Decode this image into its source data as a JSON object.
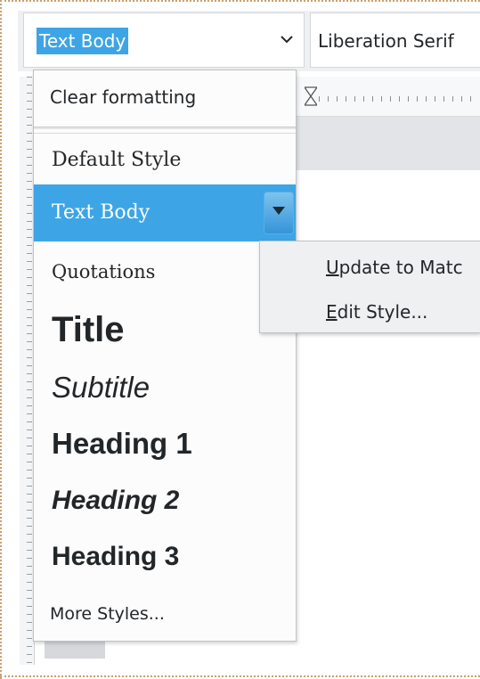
{
  "toolbar": {
    "paragraph_style": "Text Body",
    "font_name": "Liberation Serif"
  },
  "style_menu": {
    "clear_formatting": "Clear formatting",
    "items": [
      "Default Style",
      "Text Body",
      "Quotations",
      "Title",
      "Subtitle",
      "Heading 1",
      "Heading 2",
      "Heading 3"
    ],
    "selected": "Text Body",
    "more_styles": "More Styles..."
  },
  "context_menu": {
    "update_mnemonic": "U",
    "update_rest": "pdate to Matc",
    "edit_mnemonic": "E",
    "edit_rest": "dit Style..."
  },
  "colors": {
    "selection": "#3da5e5",
    "toolbar_bg": "#eef0f2",
    "menu_bg": "#fcfcfc"
  },
  "icons": {
    "style_dropdown": "chevron-down-icon",
    "item_menu": "triangle-down-icon",
    "ruler_tab": "tab-stop-icon"
  }
}
